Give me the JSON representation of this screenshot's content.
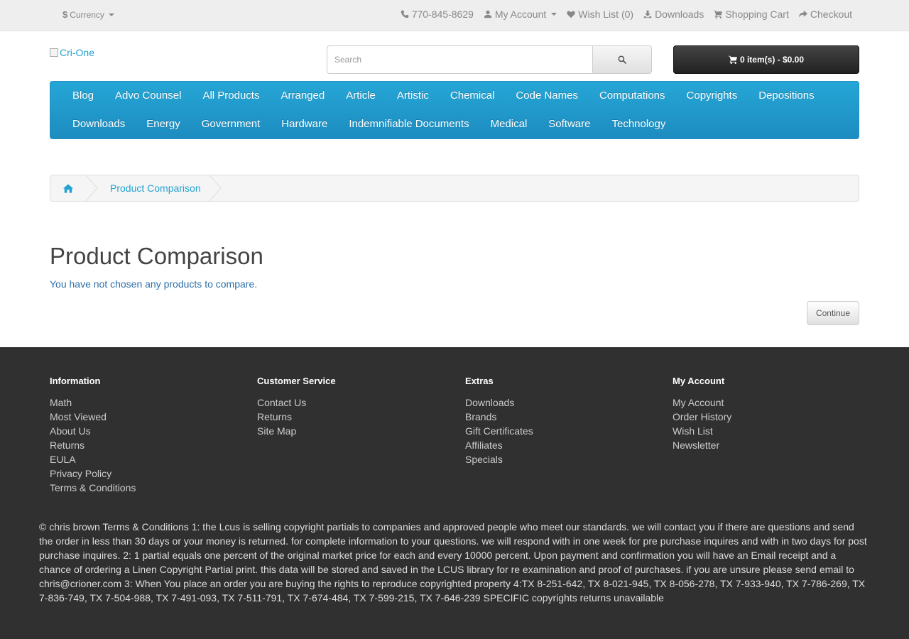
{
  "topbar": {
    "currency_label": "Currency",
    "phone": "770-845-8629",
    "my_account": "My Account",
    "wish_list": "Wish List (0)",
    "downloads": "Downloads",
    "shopping_cart": "Shopping Cart",
    "checkout": "Checkout"
  },
  "header": {
    "logo_alt": "Cri-One",
    "search_placeholder": "Search",
    "cart_button": "0 item(s) - $0.00"
  },
  "menu": {
    "row1": [
      "Blog",
      "Advo Counsel",
      "All Products",
      "Arranged",
      "Article",
      "Artistic",
      "Chemical",
      "Code Names",
      "Computations",
      "Copyrights",
      "Depositions"
    ],
    "row2": [
      "Downloads",
      "Energy",
      "Government",
      "Hardware",
      "Indemnifiable Documents",
      "Medical",
      "Software",
      "Technology"
    ]
  },
  "breadcrumb": {
    "current": "Product Comparison"
  },
  "content": {
    "title": "Product Comparison",
    "message": "You have not chosen any products to compare.",
    "continue_label": "Continue"
  },
  "footer": {
    "information": {
      "heading": "Information",
      "links": [
        "Math",
        "Most Viewed",
        "About Us",
        "Returns",
        "EULA",
        "Privacy Policy",
        "Terms & Conditions"
      ]
    },
    "customer_service": {
      "heading": "Customer Service",
      "links": [
        "Contact Us",
        "Returns",
        "Site Map"
      ]
    },
    "extras": {
      "heading": "Extras",
      "links": [
        "Downloads",
        "Brands",
        "Gift Certificates",
        "Affiliates",
        "Specials"
      ]
    },
    "my_account": {
      "heading": "My Account",
      "links": [
        "My Account",
        "Order History",
        "Wish List",
        "Newsletter"
      ]
    },
    "copyright": "© chris brown Terms & Conditions 1: the Lcus is selling copyright partials to companies and approved people who meet our standards. we will contact you if there are questions and send the order in less than 30 days or your money is returned. for complete information to your questions. we will respond with in one week for pre purchase inquires and with in two days for post purchase inquires. 2: 1 partial equals one percent of the original market price for each and every 10000 percent. Upon payment and confirmation you will have an Email receipt and a chance of ordering a Linen Copyright Partial print. this data will be stored and saved in the LCUS library for re examination and proof of purchases. if you are unsure please send email to chris@crioner.com 3: When You place an order you are buying the rights to reproduce copyrighted property 4:TX 8-251-642, TX 8-021-945, TX 8-056-278, TX 7-933-940, TX 7-786-269, TX 7-836-749, TX 7-504-988, TX 7-491-093, TX 7-511-791, TX 7-674-484, TX 7-599-215, TX 7-646-239 SPECIFIC copyrights returns unavailable"
  }
}
